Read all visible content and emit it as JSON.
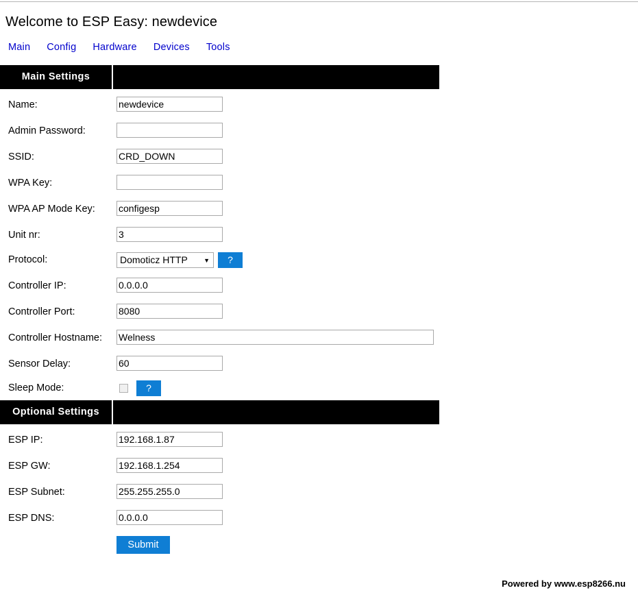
{
  "page": {
    "title": "Welcome to ESP Easy: newdevice",
    "accent_color": "#0f7ed4",
    "link_color": "#0000cc",
    "footer": "Powered by www.esp8266.nu"
  },
  "nav": {
    "items": [
      {
        "label": "Main"
      },
      {
        "label": "Config"
      },
      {
        "label": "Hardware"
      },
      {
        "label": "Devices"
      },
      {
        "label": "Tools"
      }
    ]
  },
  "main_settings": {
    "heading": "Main Settings",
    "fields": {
      "name": {
        "label": "Name:",
        "value": "newdevice"
      },
      "admin_password": {
        "label": "Admin Password:",
        "value": ""
      },
      "ssid": {
        "label": "SSID:",
        "value": "CRD_DOWN"
      },
      "wpa_key": {
        "label": "WPA Key:",
        "value": ""
      },
      "wpa_ap_mode_key": {
        "label": "WPA AP Mode Key:",
        "value": "configesp"
      },
      "unit_nr": {
        "label": "Unit nr:",
        "value": "3"
      },
      "protocol": {
        "label": "Protocol:",
        "value": "Domoticz HTTP",
        "arrow": "▼",
        "help_label": "?"
      },
      "controller_ip": {
        "label": "Controller IP:",
        "value": "0.0.0.0"
      },
      "controller_port": {
        "label": "Controller Port:",
        "value": "8080"
      },
      "controller_hostname": {
        "label": "Controller Hostname:",
        "value": "Welness"
      },
      "sensor_delay": {
        "label": "Sensor Delay:",
        "value": "60"
      },
      "sleep_mode": {
        "label": "Sleep Mode:",
        "checked": false,
        "help_label": "?"
      }
    }
  },
  "optional_settings": {
    "heading": "Optional Settings",
    "fields": {
      "esp_ip": {
        "label": "ESP IP:",
        "value": "192.168.1.87"
      },
      "esp_gw": {
        "label": "ESP GW:",
        "value": "192.168.1.254"
      },
      "esp_subnet": {
        "label": "ESP Subnet:",
        "value": "255.255.255.0"
      },
      "esp_dns": {
        "label": "ESP DNS:",
        "value": "0.0.0.0"
      }
    }
  },
  "actions": {
    "submit_label": "Submit"
  }
}
